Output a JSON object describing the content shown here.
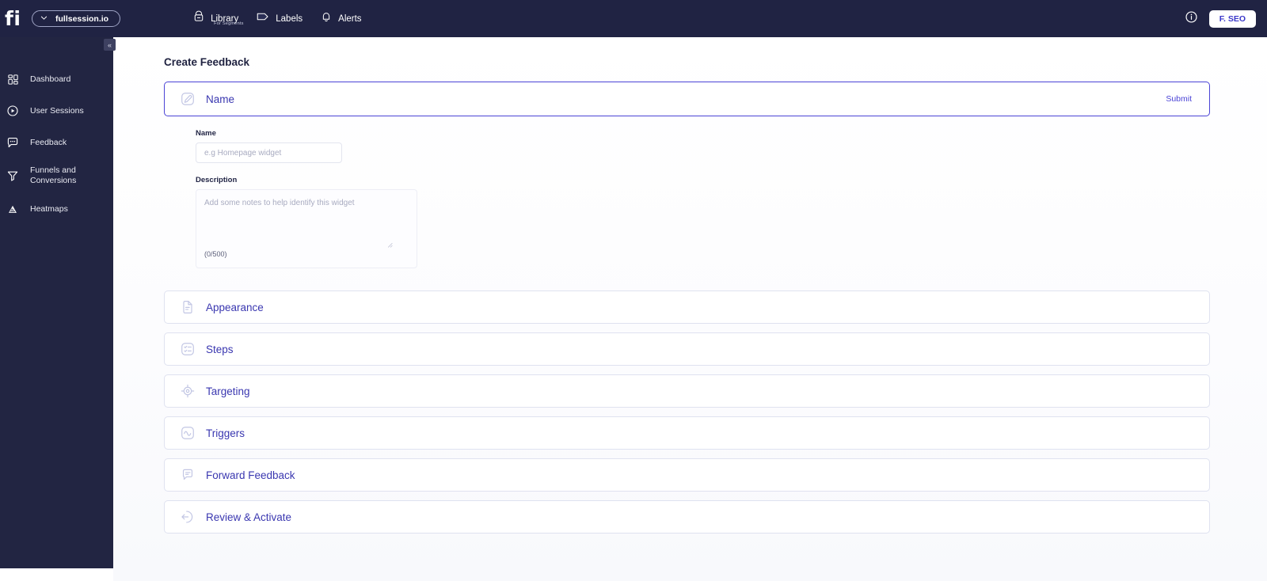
{
  "topbar": {
    "logo_text": "fi",
    "site_selector": {
      "label": "fullsession.io",
      "icon": "chevron-down-icon"
    },
    "nav": [
      {
        "label": "Library",
        "sublabel": "For Segments",
        "icon": "library-icon"
      },
      {
        "label": "Labels",
        "sublabel": "",
        "icon": "label-tag-icon"
      },
      {
        "label": "Alerts",
        "sublabel": "",
        "icon": "bell-icon"
      }
    ],
    "info_icon": "info-circle-icon",
    "user_button": "F. SEO"
  },
  "sidebar": {
    "collapse_icon": "«",
    "items": [
      {
        "label": "Dashboard",
        "icon": "dashboard-grid-icon"
      },
      {
        "label": "User Sessions",
        "icon": "play-circle-icon"
      },
      {
        "label": "Feedback",
        "icon": "chat-bubble-icon"
      },
      {
        "label": "Funnels and\nConversions",
        "icon": "funnel-icon"
      },
      {
        "label": "Heatmaps",
        "icon": "heatmap-icon"
      }
    ]
  },
  "main": {
    "page_title": "Create Feedback",
    "name_section": {
      "title": "Name",
      "icon": "pencil-square-icon",
      "submit_label": "Submit",
      "name_field": {
        "label": "Name",
        "value": "",
        "placeholder": "e.g Homepage widget"
      },
      "description_field": {
        "label": "Description",
        "value": "",
        "placeholder": "Add some notes to help identify this widget",
        "char_count": "(0/500)"
      }
    },
    "sections": [
      {
        "title": "Appearance",
        "icon": "document-icon"
      },
      {
        "title": "Steps",
        "icon": "checklist-icon"
      },
      {
        "title": "Targeting",
        "icon": "crosshair-icon"
      },
      {
        "title": "Triggers",
        "icon": "pulse-square-icon"
      },
      {
        "title": "Forward Feedback",
        "icon": "forward-chat-icon"
      },
      {
        "title": "Review & Activate",
        "icon": "arrow-left-circle-icon"
      }
    ]
  },
  "colors": {
    "topbar_bg": "#202343",
    "sidebar_bg": "#222542",
    "accent": "#4b44d6",
    "card_title": "#3a37b0",
    "icon_stroke": "#c2c6e4"
  }
}
